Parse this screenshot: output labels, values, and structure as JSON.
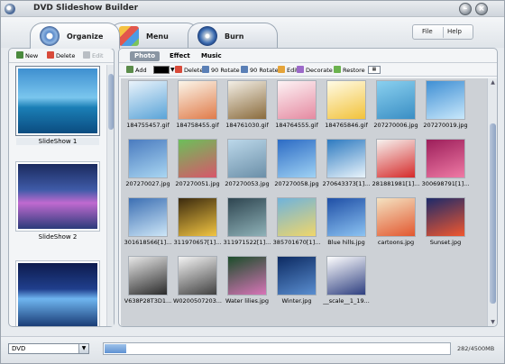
{
  "app": {
    "title": "DVD Slideshow Builder"
  },
  "window_buttons": {
    "minimize": "–",
    "close": "×"
  },
  "tabs": [
    {
      "label": "Organize",
      "icon": "organize-disc-icon"
    },
    {
      "label": "Menu",
      "icon": "menu-palette-icon"
    },
    {
      "label": "Burn",
      "icon": "burn-disc-icon"
    }
  ],
  "menu": {
    "file": "File",
    "help": "Help"
  },
  "left_toolbar": {
    "new": "New",
    "delete": "Delete",
    "edit": "Edit"
  },
  "slideshows": [
    {
      "label": "SlideShow 1",
      "selected": true
    },
    {
      "label": "SlideShow 2",
      "selected": false
    },
    {
      "label": "",
      "selected": false
    }
  ],
  "sub_tabs": {
    "photo": "Photo",
    "effect": "Effect",
    "music": "Music"
  },
  "photo_toolbar": {
    "add": "Add",
    "delete": "Delete",
    "rotate_left": "90 Rotate",
    "rotate_right": "90 Rotate",
    "edit": "Edit",
    "decorate": "Decorate",
    "restore": "Restore",
    "bg_color": "#000000"
  },
  "photos": [
    {
      "name": "184755457.gif",
      "colors": [
        "#eaf3fb",
        "#5aa4d8"
      ]
    },
    {
      "name": "184758455.gif",
      "colors": [
        "#fbf6ea",
        "#e07b4a"
      ]
    },
    {
      "name": "184761030.gif",
      "colors": [
        "#f3efe6",
        "#8a6b3c"
      ]
    },
    {
      "name": "184764555.gif",
      "colors": [
        "#fdf3f5",
        "#e58aa1"
      ]
    },
    {
      "name": "184765846.gif",
      "colors": [
        "#fffbe6",
        "#f2c23a"
      ]
    },
    {
      "name": "207270006.jpg",
      "colors": [
        "#8ad0ef",
        "#3a8ec4"
      ]
    },
    {
      "name": "207270019.jpg",
      "colors": [
        "#3f8fd4",
        "#c9e8fb"
      ]
    },
    {
      "name": "207270027.jpg",
      "colors": [
        "#4a7bbf",
        "#a9d6f2"
      ]
    },
    {
      "name": "207270051.jpg",
      "colors": [
        "#6cbf5a",
        "#d8566a"
      ]
    },
    {
      "name": "207270053.jpg",
      "colors": [
        "#bcd8ea",
        "#6b8fa8"
      ]
    },
    {
      "name": "207270058.jpg",
      "colors": [
        "#2c6bc4",
        "#9fd2f4"
      ]
    },
    {
      "name": "270643373[1]...",
      "colors": [
        "#2d7ac0",
        "#e9f4fb"
      ]
    },
    {
      "name": "281881981[1]...",
      "colors": [
        "#f7f3f0",
        "#d52a2a"
      ]
    },
    {
      "name": "300698791[1]...",
      "colors": [
        "#9c1e5a",
        "#ef7aa5"
      ]
    },
    {
      "name": "301618566[1]...",
      "colors": [
        "#3c6fb3",
        "#cde6f7"
      ]
    },
    {
      "name": "311970657[1]...",
      "colors": [
        "#3b2a0e",
        "#f2c542"
      ]
    },
    {
      "name": "311971522[1]...",
      "colors": [
        "#2e4550",
        "#8fb2b8"
      ]
    },
    {
      "name": "385701670[1]...",
      "colors": [
        "#6fb3dc",
        "#f0d66a"
      ]
    },
    {
      "name": "Blue hills.jpg",
      "colors": [
        "#1f4fa6",
        "#8cc3f2"
      ]
    },
    {
      "name": "cartoons.jpg",
      "colors": [
        "#f4e3c2",
        "#e2572f"
      ]
    },
    {
      "name": "Sunset.jpg",
      "colors": [
        "#1c2a6a",
        "#f1572f"
      ]
    },
    {
      "name": "V638P28T3D1...",
      "colors": [
        "#e8e8e8",
        "#2a2a2a"
      ]
    },
    {
      "name": "W020050720З...",
      "colors": [
        "#f4f4f4",
        "#404040"
      ]
    },
    {
      "name": "Water lilies.jpg",
      "colors": [
        "#1b4d2a",
        "#d874b8"
      ]
    },
    {
      "name": "Winter.jpg",
      "colors": [
        "#0c2a62",
        "#5a8ed0"
      ]
    },
    {
      "name": "__scale__1_19...",
      "colors": [
        "#ffffff",
        "#2e3f80"
      ]
    }
  ],
  "bottom": {
    "disc_type": "DVD",
    "capacity_text": "282/4500MB",
    "capacity_used_fraction": 0.063
  }
}
